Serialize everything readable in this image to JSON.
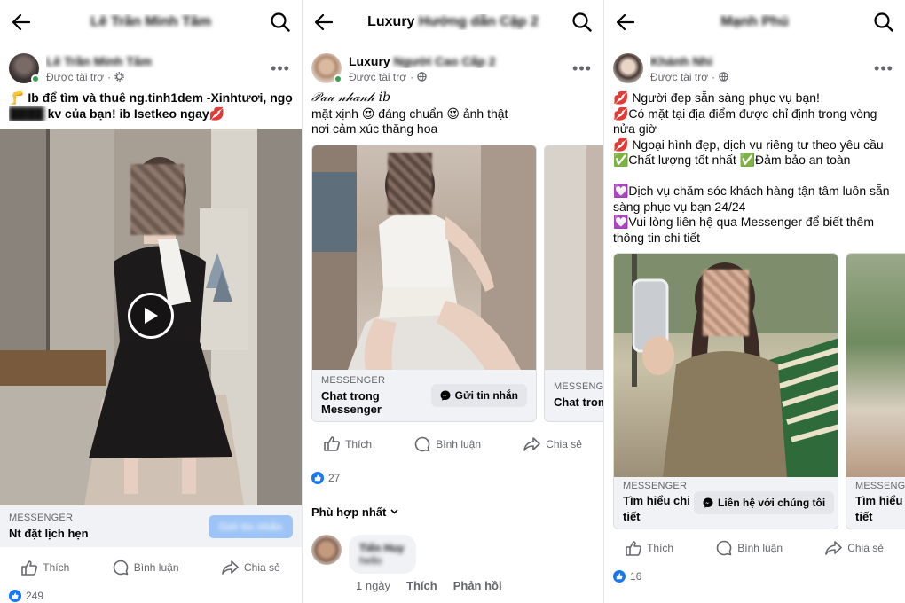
{
  "icons": {
    "back": "arrow-left-icon",
    "search": "magnifier-icon",
    "more": "ellipsis-icon",
    "like": "thumbs-up-icon",
    "comment": "speech-bubble-icon",
    "share": "share-arrow-icon",
    "globe": "globe-icon",
    "gear": "gear-icon",
    "play": "play-icon",
    "messenger": "messenger-icon"
  },
  "colors": {
    "accent": "#1877f2",
    "online": "#31a24c",
    "cta_bg": "#f0f2f5"
  },
  "panels": [
    {
      "title": "Lê Trần Minh Tâm",
      "post": {
        "author": "Lê Trần Minh Tâm",
        "sponsored": "Được tài trợ",
        "text": [
          "🦵 Ib để tìm và thuê ng.tinh1dem -Xinhtươi, ngọt",
          "████ kv của bạn! ib Isetkeo ngay💋"
        ],
        "cta": {
          "kicker": "MESSENGER",
          "headline": "Nt đặt lịch hẹn",
          "button": "Gửi tin nhắn"
        },
        "actions": {
          "like": "Thích",
          "comment": "Bình luận",
          "share": "Chia sẻ"
        },
        "reactions": "249"
      }
    },
    {
      "title": "Luxury",
      "title_tail": "Hướng dẫn Cặp 2",
      "post": {
        "author": "Luxury",
        "author_tail": "Người Cao Cấp 2",
        "sponsored": "Được tài trợ",
        "text": [
          "𝒫𝒶𝓊 𝓃𝒽𝒶𝓃𝒽 ib",
          "mặt xịnh 😍 đáng chuẩn 😍 ảnh thật",
          "nơi cảm xúc thăng hoa"
        ],
        "cards": [
          {
            "kicker": "MESSENGER",
            "headline": "Chat trong Messenger",
            "button": "Gửi tin nhắn"
          },
          {
            "kicker": "MESSENGE",
            "headline": "Chat trong"
          }
        ],
        "actions": {
          "like": "Thích",
          "comment": "Bình luận",
          "share": "Chia sẻ"
        },
        "reactions": "27",
        "sort": "Phù hợp nhất",
        "comment": {
          "name": "Tiến Huy",
          "text": "hello",
          "time": "1 ngày",
          "like": "Thích",
          "reply": "Phản hồi"
        }
      }
    },
    {
      "title": "Mạnh Phú",
      "post": {
        "author": "Khánh Nhi",
        "sponsored": "Được tài trợ",
        "text": [
          "💋 Người đẹp sẵn sàng phục vụ bạn!",
          "💋Có mặt tại địa điểm được chỉ định trong vòng",
          "nửa giờ",
          "💋 Ngoại hình đẹp, dịch vụ riêng tư theo yêu cầu",
          "✅Chất lượng tốt nhất ✅Đảm bảo an toàn",
          "",
          "💟Dịch vụ chăm sóc khách hàng tận tâm luôn sẵn",
          "sàng phục vụ bạn 24/24",
          "💟Vui lòng liên hệ qua Messenger để biết thêm",
          "thông tin chi tiết"
        ],
        "cards": [
          {
            "kicker": "MESSENGER",
            "headline": "Tìm hiểu chi tiết",
            "button": "Liên hệ với chúng tôi"
          },
          {
            "kicker": "MESSENGE",
            "headline": "Tìm hiểu tiết"
          }
        ],
        "actions": {
          "like": "Thích",
          "comment": "Bình luận",
          "share": "Chia sẻ"
        },
        "reactions": "16"
      }
    }
  ]
}
